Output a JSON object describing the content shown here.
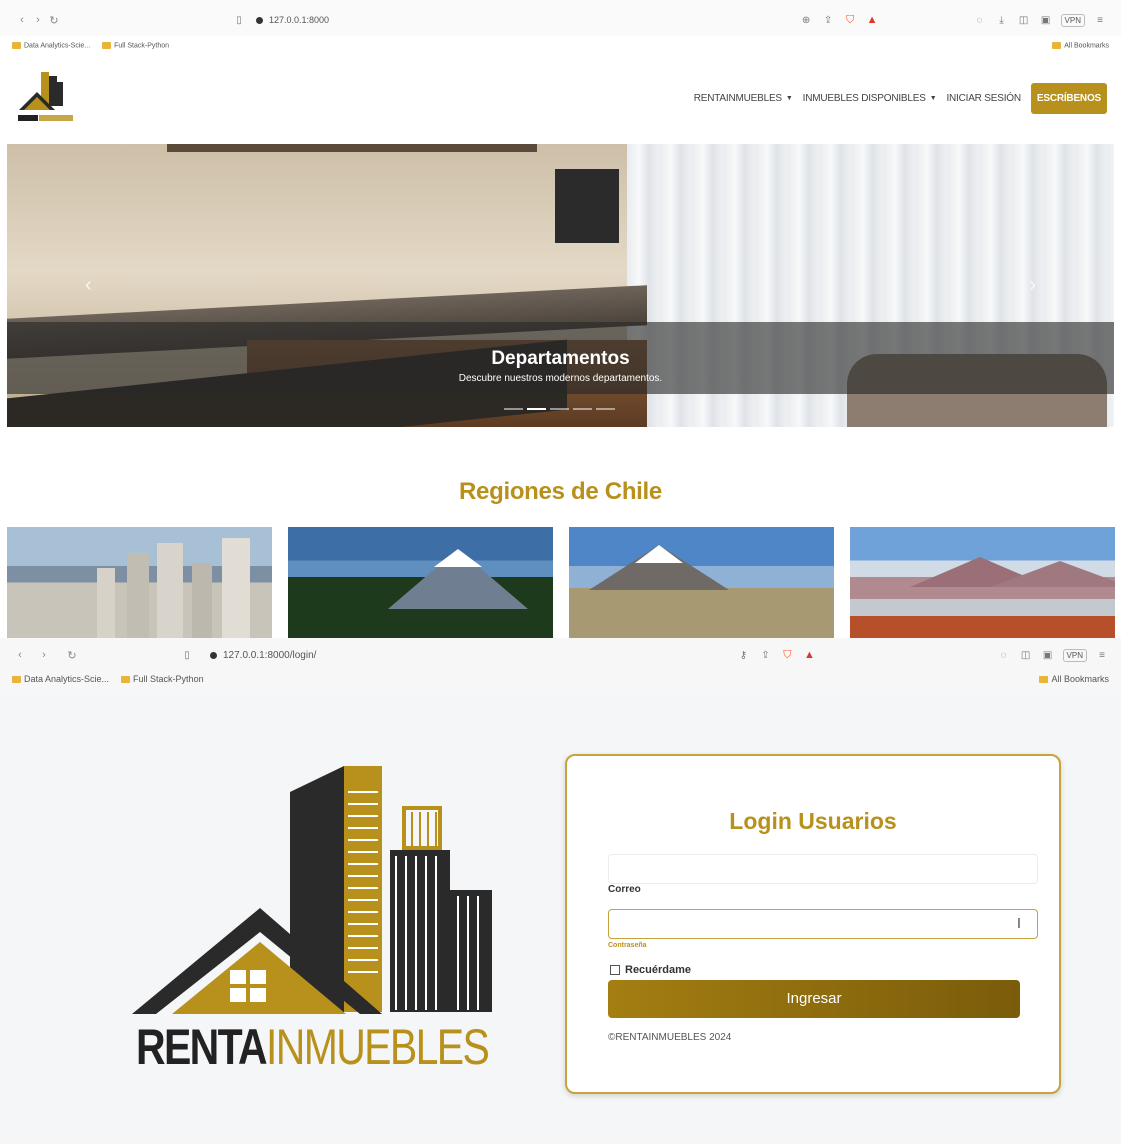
{
  "window1": {
    "url": "127.0.0.1:8000",
    "bookmarks": [
      "Data Analytics-Scie...",
      "Full Stack-Python"
    ],
    "all_bookmarks": "All Bookmarks",
    "vpn": "VPN",
    "nav": {
      "menu": [
        {
          "label": "RENTAINMUEBLES",
          "has_caret": true
        },
        {
          "label": "INMUEBLES DISPONIBLES",
          "has_caret": true
        },
        {
          "label": "INICIAR SESIÓN",
          "has_caret": false
        }
      ],
      "cta": "ESCRÍBENOS"
    },
    "carousel": {
      "title": "Departamentos",
      "subtitle": "Descubre nuestros modernos departamentos.",
      "slides": 5,
      "active_slide": 2
    },
    "regions_title": "Regiones de Chile"
  },
  "window2": {
    "url": "127.0.0.1:8000/login/",
    "bookmarks": [
      "Data Analytics-Scie...",
      "Full Stack-Python"
    ],
    "all_bookmarks": "All Bookmarks",
    "vpn": "VPN",
    "brand": {
      "part1": "RENTA",
      "part2": "INMUEBLES"
    },
    "login": {
      "title": "Login Usuarios",
      "email_label": "Correo",
      "password_label": "Contraseña",
      "remember_label": "Recuérdame",
      "submit": "Ingresar",
      "copyright": "©RENTAINMUEBLES 2024"
    }
  },
  "colors": {
    "brand_gold": "#b8911c",
    "dark": "#222222"
  }
}
